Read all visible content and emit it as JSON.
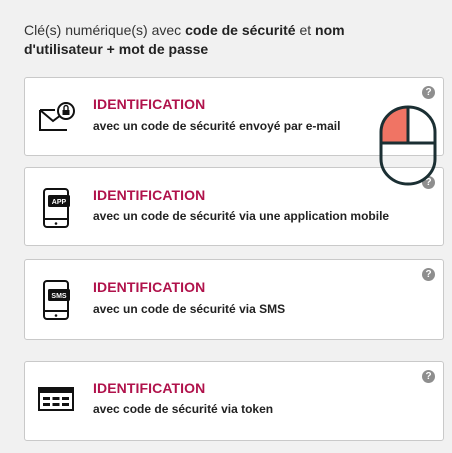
{
  "heading": {
    "prefix": "Clé(s) numérique(s) avec ",
    "bold1": "code de sécurité",
    "middle": " et ",
    "bold2": "nom d'utilisateur + mot de passe"
  },
  "options": [
    {
      "title": "IDENTIFICATION",
      "desc": "avec un code de sécurité envoyé par e-mail",
      "icon": "email-lock-icon"
    },
    {
      "title": "IDENTIFICATION",
      "desc": "avec un code de sécurité via une application mobile",
      "icon": "phone-app-icon",
      "badge": "APP"
    },
    {
      "title": "IDENTIFICATION",
      "desc": "avec un code de sécurité via SMS",
      "icon": "phone-sms-icon",
      "badge": "SMS"
    },
    {
      "title": "IDENTIFICATION",
      "desc": "avec code de sécurité via token",
      "icon": "token-icon"
    }
  ],
  "help_glyph": "?",
  "colors": {
    "accent": "#b0124b",
    "cursor_fill": "#f07464",
    "cursor_outline": "#1b2f33"
  }
}
